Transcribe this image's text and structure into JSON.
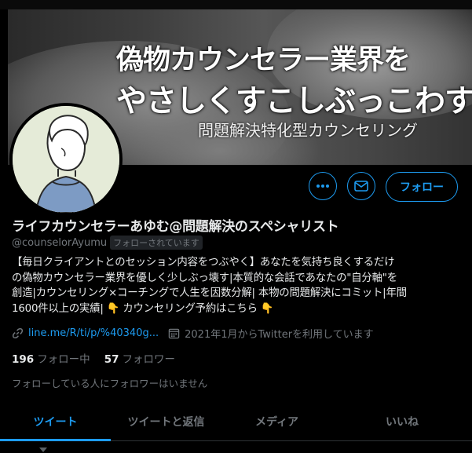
{
  "top_fragment": "",
  "banner": {
    "line1": "偽物カウンセラー業界を",
    "line2": "やさしくすこしぶっこわす",
    "line3": "問題解決特化型カウンセリング"
  },
  "actions": {
    "follow_label": "フォロー"
  },
  "profile": {
    "name": "ライフカウンセラーあゆむ@問題解決のスペシャリスト",
    "handle": "@counselorAyumu",
    "follows_you": "フォローされています",
    "bio_lines": [
      "【毎日クライアントとのセッション内容をつぶやく】あなたを気持ち良くするだけ",
      "の偽物カウンセラー業界を優しく少しぶっ壊す|本質的な会話であなたの\"自分軸\"を",
      "創造|カウンセリング×コーチングで人生を因数分解| 本物の問題解決にコミット|年間",
      "1600件以上の実績| 👇 カウンセリング予約はこちら 👇"
    ],
    "link": "line.me/R/ti/p/%40340g...",
    "joined": "2021年1月からTwitterを利用しています"
  },
  "counts": {
    "following_num": "196",
    "following_label": "フォロー中",
    "followers_num": "57",
    "followers_label": "フォロワー"
  },
  "notice": "フォローしている人にフォロワーはいません",
  "tabs": [
    "ツイート",
    "ツイートと返信",
    "メディア",
    "いいね"
  ],
  "colors": {
    "accent": "#1d9bf0",
    "background": "#000000",
    "muted": "#71767b"
  }
}
